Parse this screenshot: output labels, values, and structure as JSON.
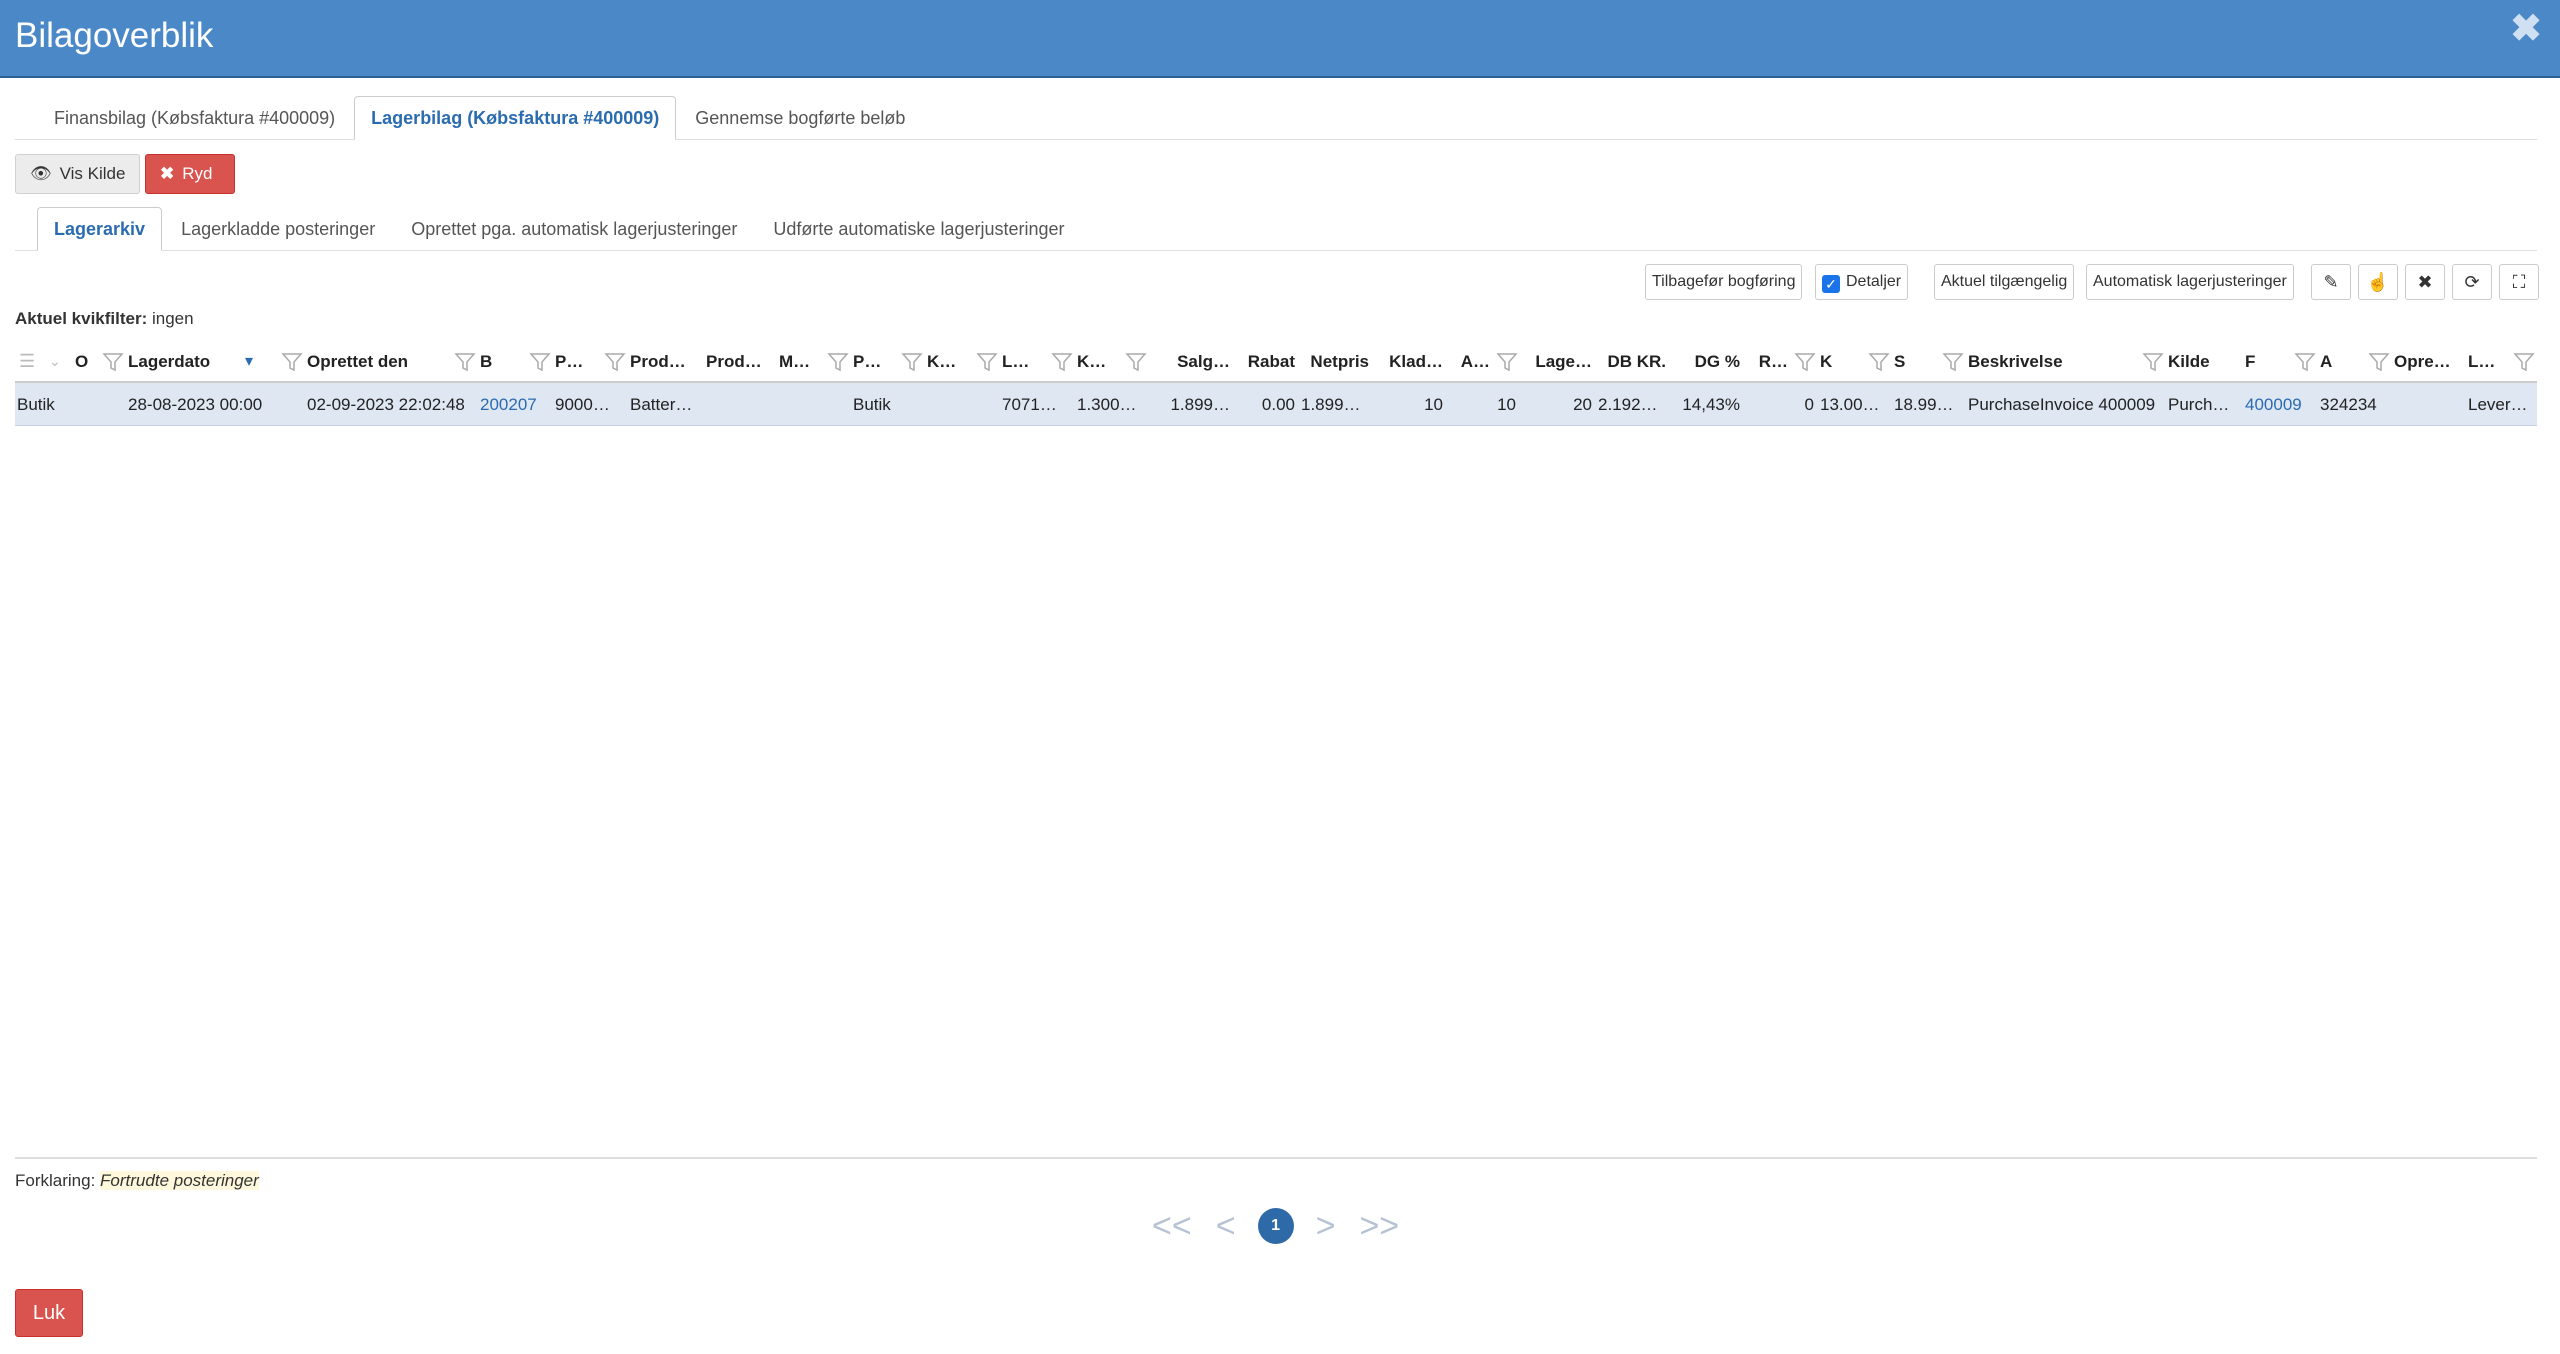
{
  "window": {
    "title": "Bilagoverblik"
  },
  "outer_tabs": [
    {
      "label": "Finansbilag (Købsfaktura #400009)"
    },
    {
      "label": "Lagerbilag (Købsfaktura #400009)"
    },
    {
      "label": "Gennemse bogførte beløb"
    }
  ],
  "actions": {
    "show_source": "Vis Kilde",
    "clear": "Ryd"
  },
  "inner_tabs": [
    {
      "label": "Lagerarkiv"
    },
    {
      "label": "Lagerkladde posteringer"
    },
    {
      "label": "Oprettet pga. automatisk lagerjusteringer"
    },
    {
      "label": "Udførte automatiske lagerjusteringer"
    }
  ],
  "toolbar": {
    "revert": "Tilbagefør bogføring",
    "details": "Detaljer",
    "details_checked": true,
    "current_available": "Aktuel tilgængelig",
    "auto_adjust": "Automatisk lagerjusteringer"
  },
  "quickfilter": {
    "label": "Aktuel kvikfilter:",
    "value": "ingen"
  },
  "grid": {
    "columns": [
      "O",
      "Lagerdato",
      "Oprettet den",
      "B",
      "P…",
      "Prod…",
      "Prod…",
      "M…",
      "P…",
      "K…",
      "L…",
      "K…",
      "Salg…",
      "Rabat",
      "Netpris",
      "Klad…",
      "A…",
      "Lage…",
      "DB KR.",
      "DG %",
      "R…",
      "K",
      "S",
      "Beskrivelse",
      "Kilde",
      "F",
      "A",
      "Opre…",
      "L…"
    ],
    "rows": [
      [
        "Butik",
        "28-08-2023 00:00",
        "02-09-2023 22:02:48",
        "200207",
        "9000…",
        "Batter…",
        "",
        "",
        "Butik",
        "",
        "7071…",
        "1.300…",
        "1.899…",
        "0.00",
        "1.899…",
        "10",
        "10",
        "20",
        "2.192…",
        "14,43%",
        "0",
        "13.00…",
        "18.99…",
        "PurchaseInvoice 400009",
        "Purch…",
        "400009",
        "324234",
        "",
        "Lever…"
      ]
    ]
  },
  "legend": {
    "label": "Forklaring:",
    "value": "Fortrudte posteringer"
  },
  "pager": {
    "first": "<<",
    "prev": "<",
    "current": "1",
    "next": ">",
    "last": ">>"
  },
  "footer": {
    "close": "Luk"
  }
}
